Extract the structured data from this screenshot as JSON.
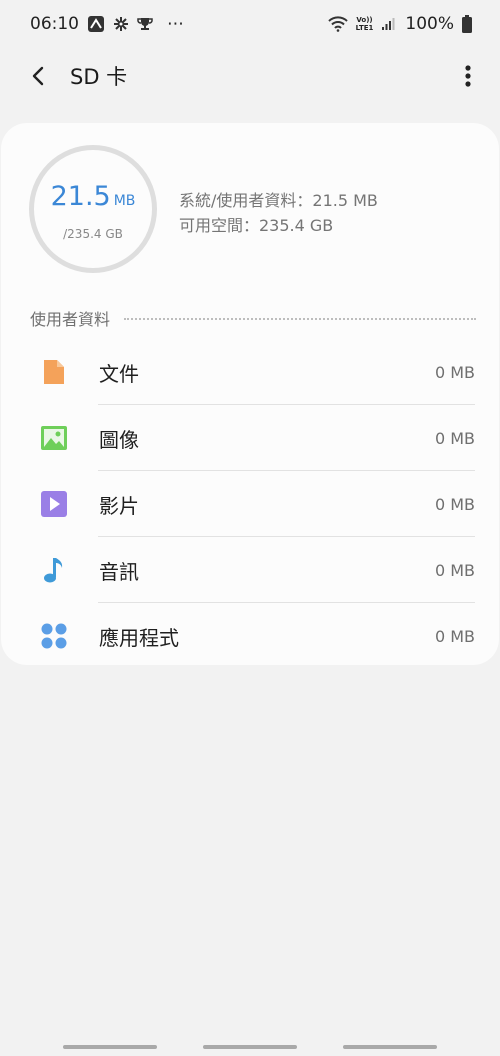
{
  "status_bar": {
    "time": "06:10",
    "more_symbol": "⋯",
    "battery_percent": "100%",
    "network_label_top": "Vo))",
    "network_label_bottom": "LTE1"
  },
  "app_bar": {
    "title": "SD 卡"
  },
  "storage": {
    "used_value": "21.5",
    "used_unit": "MB",
    "total": "/235.4 GB",
    "system_line": "系統/使用者資料：21.5 MB",
    "available_line": "可用空間：235.4 GB",
    "ring_color": "#3b87d6"
  },
  "user_data": {
    "section_title": "使用者資料",
    "items": [
      {
        "label": "文件",
        "size": "0 MB",
        "icon": "document-icon",
        "color": "#f4a25a"
      },
      {
        "label": "圖像",
        "size": "0 MB",
        "icon": "image-icon",
        "color": "#6fcf5a"
      },
      {
        "label": "影片",
        "size": "0 MB",
        "icon": "video-icon",
        "color": "#9a7fe6"
      },
      {
        "label": "音訊",
        "size": "0 MB",
        "icon": "music-note-icon",
        "color": "#3f9ad8"
      },
      {
        "label": "應用程式",
        "size": "0 MB",
        "icon": "apps-icon",
        "color": "#5b9ee6"
      }
    ]
  }
}
